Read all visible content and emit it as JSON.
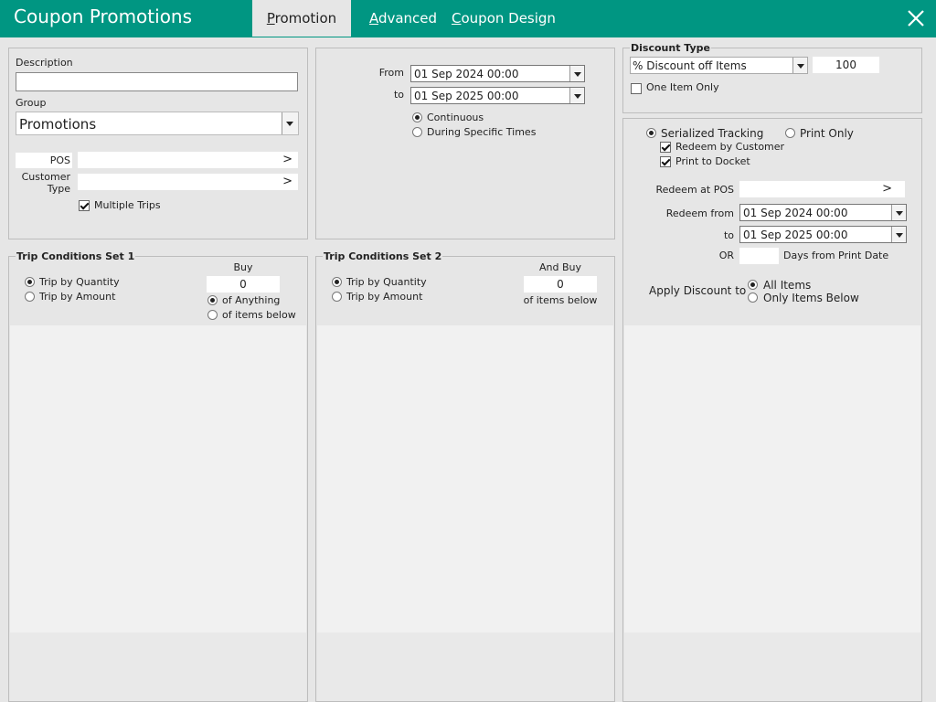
{
  "window": {
    "title": "Coupon Promotions",
    "tabs": [
      {
        "label": "Promotion",
        "mnemonic": "P",
        "rest": "romotion"
      },
      {
        "label": "Advanced",
        "mnemonic": "A",
        "rest": "dvanced"
      },
      {
        "label": "Coupon Design",
        "mnemonic": "C",
        "rest": "oupon Design"
      }
    ],
    "close_icon": "close-icon",
    "accent_color": "#009682"
  },
  "details": {
    "description_label": "Description",
    "description_value": "",
    "group_label": "Group",
    "group_value": "Promotions",
    "pos_label": "POS",
    "pos_value": "",
    "pos_picker": ">",
    "customer_type_label_1": "Customer",
    "customer_type_label_2": "Type",
    "customer_type_value": "",
    "customer_type_picker": ">",
    "multiple_trips_label": "Multiple Trips",
    "multiple_trips_checked": true
  },
  "schedule": {
    "from_label": "From",
    "from_value": "01 Sep  2024 00:00",
    "to_label": "to",
    "to_value": "01 Sep  2025 00:00",
    "continuous_label": "Continuous",
    "continuous_selected": true,
    "specific_times_label": "During Specific Times"
  },
  "discount": {
    "group_title": "Discount Type",
    "type_value": "% Discount off Items",
    "amount_value": "100",
    "one_item_only_label": "One Item Only",
    "one_item_only_checked": false
  },
  "trip1": {
    "title": "Trip Conditions Set 1",
    "by_quantity_label": "Trip by Quantity",
    "by_quantity_selected": true,
    "by_amount_label": "Trip by Amount",
    "buy_label": "Buy",
    "buy_value": "0",
    "of_anything_label": "of Anything",
    "of_anything_selected": true,
    "of_items_below_label": "of items below"
  },
  "trip2": {
    "title": "Trip Conditions Set 2",
    "by_quantity_label": "Trip by Quantity",
    "by_quantity_selected": true,
    "by_amount_label": "Trip by Amount",
    "and_buy_label": "And Buy",
    "and_buy_value": "0",
    "of_items_below_label": "of items below"
  },
  "redeem": {
    "serialized_label": "Serialized Tracking",
    "serialized_selected": true,
    "print_only_label": "Print Only",
    "by_customer_label": "Redeem by Customer",
    "by_customer_checked": true,
    "print_docket_label": "Print to Docket",
    "print_docket_checked": true,
    "at_pos_label": "Redeem at POS",
    "at_pos_value": "",
    "at_pos_picker": ">",
    "from_label": "Redeem from",
    "from_value": "01 Sep  2024 00:00",
    "to_label": "to",
    "to_value": "01 Sep  2025 00:00",
    "or_label": "OR",
    "days_value": "",
    "days_label": "Days from Print Date",
    "apply_label": "Apply Discount to",
    "all_items_label": "All Items",
    "all_items_selected": true,
    "only_below_label": "Only Items Below"
  }
}
